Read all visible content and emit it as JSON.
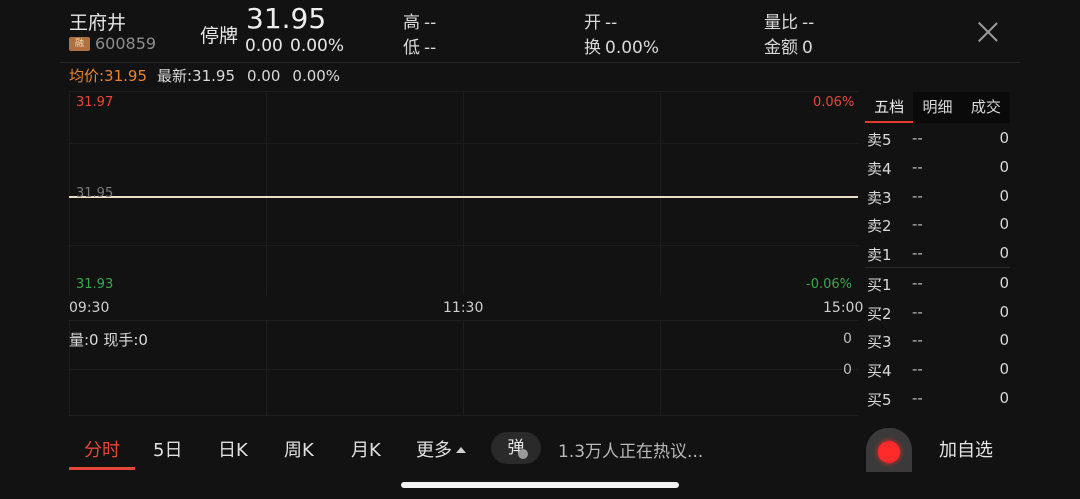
{
  "header": {
    "stock_name": "王府井",
    "rong_badge": "融",
    "stock_code": "600859",
    "status": "停牌",
    "price": "31.95",
    "change": "0.00",
    "change_pct": "0.00%",
    "high_label": "高",
    "high_value": "--",
    "low_label": "低",
    "low_value": "--",
    "open_label": "开",
    "open_value": "--",
    "turnover_label": "换",
    "turnover_value": "0.00%",
    "volume_ratio_label": "量比",
    "volume_ratio_value": "--",
    "amount_label": "金额",
    "amount_value": "0"
  },
  "summary": {
    "avg_price": "均价:31.95",
    "latest": "最新:31.95",
    "latest_change": "0.00",
    "latest_pct": "0.00%"
  },
  "chart": {
    "top_price": "31.97",
    "top_pct": "0.06%",
    "mid_price": "31.95",
    "bottom_price": "31.93",
    "bottom_pct": "-0.06%",
    "time_start": "09:30",
    "time_mid": "11:30",
    "time_end": "15:00",
    "volume_label": "量:0 现手:0",
    "vol_axis_top": "0",
    "vol_axis_bottom": "0"
  },
  "order_book": {
    "tabs": [
      "五档",
      "明细",
      "成交"
    ],
    "rows": [
      {
        "side": "卖5",
        "price": "--",
        "volume": "0"
      },
      {
        "side": "卖4",
        "price": "--",
        "volume": "0"
      },
      {
        "side": "卖3",
        "price": "--",
        "volume": "0"
      },
      {
        "side": "卖2",
        "price": "--",
        "volume": "0"
      },
      {
        "side": "卖1",
        "price": "--",
        "volume": "0"
      },
      {
        "side": "买1",
        "price": "--",
        "volume": "0"
      },
      {
        "side": "买2",
        "price": "--",
        "volume": "0"
      },
      {
        "side": "买3",
        "price": "--",
        "volume": "0"
      },
      {
        "side": "买4",
        "price": "--",
        "volume": "0"
      },
      {
        "side": "买5",
        "price": "--",
        "volume": "0"
      }
    ]
  },
  "bottom_bar": {
    "tabs": [
      "分时",
      "5日",
      "日K",
      "周K",
      "月K",
      "更多"
    ],
    "danmu_label": "弹",
    "discussion": "1.3万人正在热议...",
    "add_favorite": "加自选"
  },
  "colors": {
    "up": "#e5473a",
    "down": "#3aa64c",
    "avg": "#e8862f",
    "price_line": "#e8dfc3",
    "background": "#121212"
  }
}
